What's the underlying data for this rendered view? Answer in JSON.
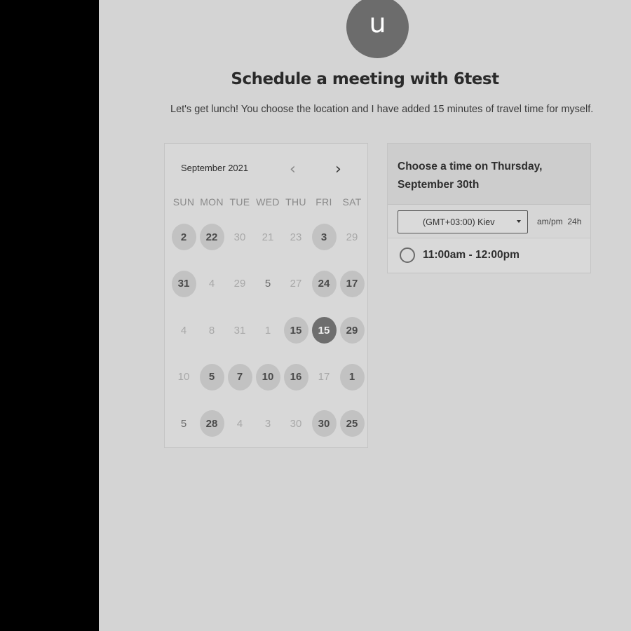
{
  "host": {
    "avatar_initial": "u",
    "title": "Schedule a meeting with 6test",
    "description": "Let's get lunch! You choose the location and I have added 15 minutes of travel time for myself."
  },
  "calendar": {
    "month_label": "September 2021",
    "prev_icon": "chevron-left-icon",
    "next_icon": "chevron-right-icon",
    "weekdays": [
      "SUN",
      "MON",
      "TUE",
      "WED",
      "THU",
      "FRI",
      "SAT"
    ],
    "weeks": [
      [
        {
          "d": "2",
          "s": "avail"
        },
        {
          "d": "22",
          "s": "avail"
        },
        {
          "d": "30",
          "s": "off"
        },
        {
          "d": "21",
          "s": "off"
        },
        {
          "d": "23",
          "s": "off"
        },
        {
          "d": "3",
          "s": "avail"
        },
        {
          "d": "29",
          "s": "off"
        }
      ],
      [
        {
          "d": "31",
          "s": "avail"
        },
        {
          "d": "4",
          "s": "off"
        },
        {
          "d": "29",
          "s": "off"
        },
        {
          "d": "5",
          "s": "plain"
        },
        {
          "d": "27",
          "s": "off"
        },
        {
          "d": "24",
          "s": "avail"
        },
        {
          "d": "17",
          "s": "avail"
        }
      ],
      [
        {
          "d": "4",
          "s": "off"
        },
        {
          "d": "8",
          "s": "off"
        },
        {
          "d": "31",
          "s": "off"
        },
        {
          "d": "1",
          "s": "off"
        },
        {
          "d": "15",
          "s": "avail"
        },
        {
          "d": "15",
          "s": "selected"
        },
        {
          "d": "29",
          "s": "avail"
        }
      ],
      [
        {
          "d": "10",
          "s": "off"
        },
        {
          "d": "5",
          "s": "avail"
        },
        {
          "d": "7",
          "s": "avail"
        },
        {
          "d": "10",
          "s": "avail"
        },
        {
          "d": "16",
          "s": "avail"
        },
        {
          "d": "17",
          "s": "off"
        },
        {
          "d": "1",
          "s": "avail"
        }
      ],
      [
        {
          "d": "5",
          "s": "plain"
        },
        {
          "d": "28",
          "s": "avail"
        },
        {
          "d": "4",
          "s": "off"
        },
        {
          "d": "3",
          "s": "off"
        },
        {
          "d": "30",
          "s": "off"
        },
        {
          "d": "30",
          "s": "avail"
        },
        {
          "d": "25",
          "s": "avail"
        }
      ]
    ]
  },
  "times": {
    "heading_line1": "Choose a time on Thursday,",
    "heading_line2": "September 30th",
    "timezone": "(GMT+03:00) Kiev",
    "format_12h": "am/pm",
    "format_24h": "24h",
    "slots": [
      "11:00am - 12:00pm"
    ]
  }
}
